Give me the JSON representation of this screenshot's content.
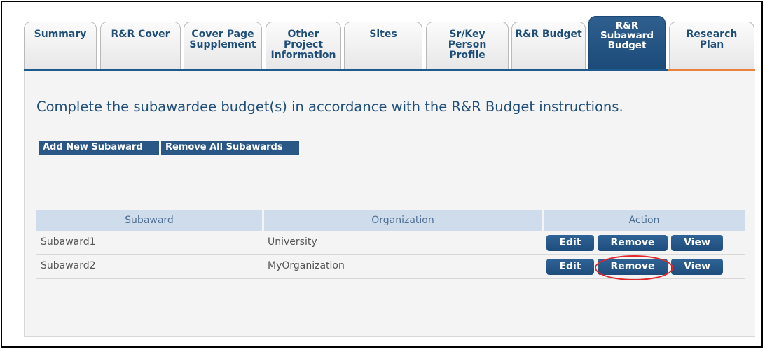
{
  "tabs": [
    {
      "label": "Summary"
    },
    {
      "label": "R&R Cover"
    },
    {
      "label": "Cover Page\nSupplement"
    },
    {
      "label": "Other\nProject\nInformation"
    },
    {
      "label": "Sites"
    },
    {
      "label": "Sr/Key\nPerson\nProfile"
    },
    {
      "label": "R&R Budget"
    },
    {
      "label": "R&R\nSubaward\nBudget",
      "active": true
    },
    {
      "label": "Research\nPlan"
    }
  ],
  "main": {
    "instruction": "Complete the subawardee budget(s) in accordance with the R&R Budget instructions.",
    "add_button": "Add New Subaward",
    "remove_all_button": "Remove All Subawards"
  },
  "table": {
    "headers": [
      "Subaward",
      "Organization",
      "Action"
    ],
    "rows": [
      {
        "subaward": "Subaward1",
        "organization": "University",
        "edit": "Edit",
        "remove": "Remove",
        "view": "View"
      },
      {
        "subaward": "Subaward2",
        "organization": "MyOrganization",
        "edit": "Edit",
        "remove": "Remove",
        "view": "View"
      }
    ]
  },
  "colors": {
    "accent": "#1f4e79",
    "active_tab": "#1b4a78",
    "tab_underline_right": "#e8823c",
    "highlight": "#e0252b"
  }
}
